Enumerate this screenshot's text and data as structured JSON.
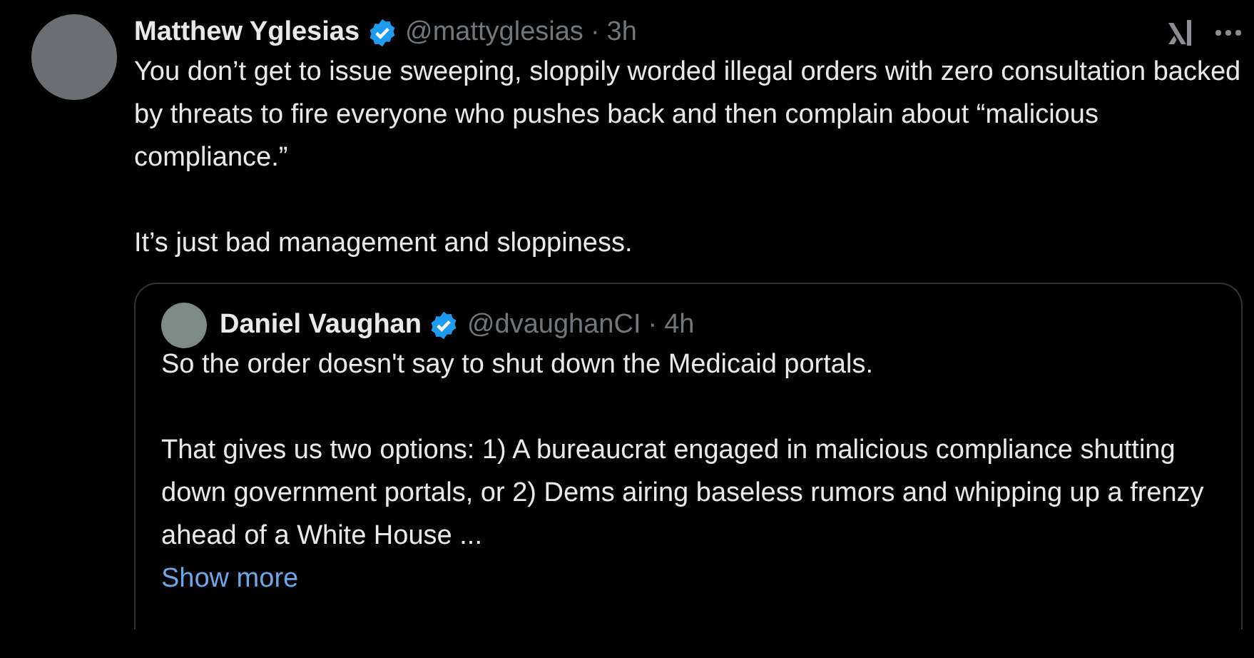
{
  "post": {
    "author": "Matthew Yglesias",
    "verified": true,
    "handle": "@mattyglesias",
    "separator": "·",
    "time": "3h",
    "paragraphs": [
      "You don’t get to issue sweeping, sloppily worded illegal orders with zero consultation backed by threats to fire everyone who pushes back and then complain about “malicious compliance.”",
      "It’s just bad management and sloppiness."
    ]
  },
  "quote": {
    "author": "Daniel Vaughan",
    "verified": true,
    "handle": "@dvaughanCI",
    "separator": "·",
    "time": "4h",
    "paragraphs": [
      "So the order doesn't say to shut down the Medicaid portals.",
      "That gives us two options: 1) A bureaucrat engaged in malicious compliance shutting down government portals, or 2) Dems airing baseless rumors and whipping up a frenzy ahead of a White House ..."
    ],
    "show_more": "Show more"
  }
}
